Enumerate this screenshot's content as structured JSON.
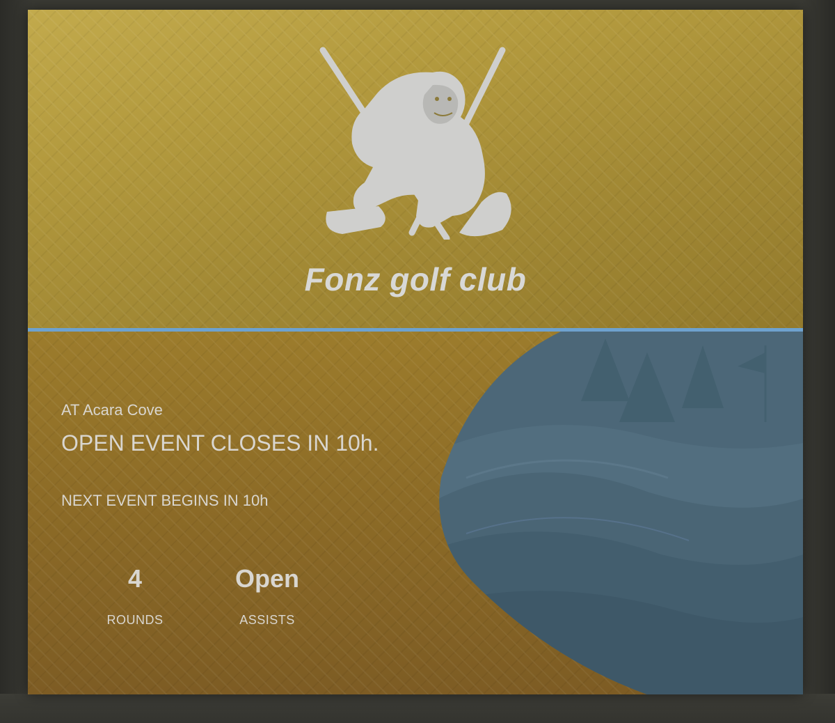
{
  "club": {
    "name": "Fonz golf club"
  },
  "event": {
    "venue": "AT Acara Cove",
    "closes": "OPEN EVENT CLOSES IN 10h.",
    "next": "NEXT EVENT BEGINS IN 10h"
  },
  "stats": [
    {
      "value": "4",
      "label": "ROUNDS"
    },
    {
      "value": "Open",
      "label": "ASSISTS"
    }
  ],
  "colors": {
    "gold_top": "#b39a3e",
    "gold_bottom": "#8d6c27",
    "divider": "#6ea2cf",
    "course": "#4c6778"
  },
  "icons": [
    "gorilla-golf-logo-icon",
    "golf-course-illustration"
  ]
}
